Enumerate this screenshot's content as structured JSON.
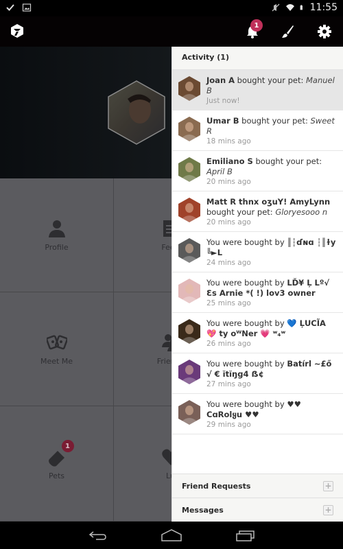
{
  "status_bar": {
    "time": "11:55",
    "left_icons": [
      "check-icon",
      "image-icon"
    ],
    "right_icons": [
      "mute-icon",
      "wifi-icon",
      "battery-icon"
    ]
  },
  "app_bar": {
    "logo": "app-logo-icon",
    "notification_count": "1",
    "actions": [
      "bell-icon",
      "brush-icon",
      "gear-icon"
    ]
  },
  "main": {
    "tiles": [
      {
        "label": "Profile",
        "icon": "person-icon"
      },
      {
        "label": "Feed",
        "icon": "feed-icon"
      },
      {
        "label": "Meet Me",
        "icon": "meet-me-icon"
      },
      {
        "label": "Friends",
        "icon": "friends-icon"
      },
      {
        "label": "Pets",
        "icon": "pet-tag-icon",
        "badge": "1"
      },
      {
        "label": "Lu",
        "icon": "heart-icon"
      }
    ]
  },
  "panel": {
    "title": "Activity (1)",
    "items": [
      {
        "name": "Joan A",
        "action": " bought your pet: ",
        "pet": "Manuel B",
        "time": "Just now!",
        "highlight": true,
        "avatar_color": "#6b4a32"
      },
      {
        "name": "Umar B",
        "action": " bought your pet: ",
        "pet": "Sweet R",
        "time": "18 mins ago",
        "avatar_color": "#8a6b50"
      },
      {
        "name": "Emiliano S",
        "action": " bought your pet: ",
        "pet": "April B",
        "time": "20 mins ago",
        "avatar_color": "#6f7a48"
      },
      {
        "name": "Matt R thnx oʒuY! AmyLynn",
        "action": " bought your pet: ",
        "pet": "Gloryesooo n",
        "time": "20 mins ago",
        "avatar_color": "#a0422a"
      },
      {
        "prefix": "You were bought by ",
        "name": "║┆ɗɴɑ ┆║ɫy ╚►L",
        "time": "24 mins ago",
        "avatar_color": "#5a5a5a"
      },
      {
        "prefix": "You were bought by ",
        "name": "LĎ¥ Ļ Lº√ Ɛs Arnie *( !) lov3 owner",
        "time": "25 mins ago",
        "avatar_color": "#e2b8b8"
      },
      {
        "prefix": "You were bought by ",
        "name": "💙 ĻUCĨA 💖 ty oᵂNer 💗 ʷ₄ʷ",
        "time": "26 mins ago",
        "avatar_color": "#3a2a1a"
      },
      {
        "prefix": "You were bought by ",
        "name": "Batírl ~£ő √ € ĭtĭŋg4 ẞ¢",
        "time": "27 mins ago",
        "avatar_color": "#6a3a7a"
      },
      {
        "prefix": "You were bought by ",
        "name": "♥♥ ϹɑRolყu ♥♥",
        "time": "29 mins ago",
        "avatar_color": "#7a6058"
      }
    ],
    "footer": [
      {
        "label": "Friend Requests",
        "icon": "plus-icon"
      },
      {
        "label": "Messages",
        "icon": "plus-icon"
      }
    ]
  },
  "nav_bar": {
    "buttons": [
      "back-icon",
      "home-icon",
      "recent-apps-icon"
    ]
  },
  "colors": {
    "badge": "#c0305a",
    "pets_badge": "#7a1c33",
    "highlight_row": "#e6e6e6",
    "grid_bg": "#5b5b5f"
  }
}
